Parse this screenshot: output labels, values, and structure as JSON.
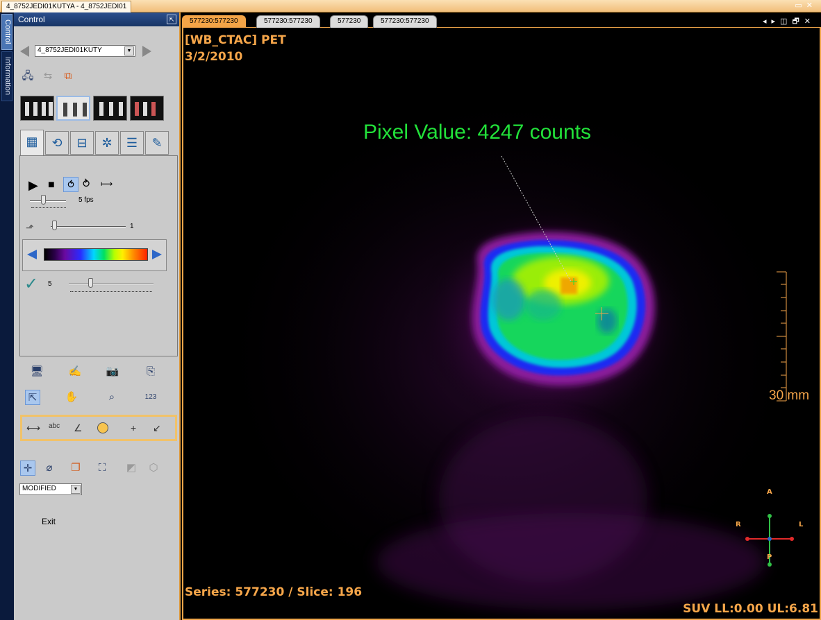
{
  "window": {
    "title": "4_8752JEDI01KUTYA - 4_8752JEDI01"
  },
  "side_tabs": {
    "control": "Control",
    "information": "Information"
  },
  "panel": {
    "header": "Control",
    "patient_select": "4_8752JEDI01KUTY",
    "frame_rate_label": "5 fps",
    "frame_step_value": "1",
    "threshold_value": "5",
    "mode_select": "MODIFIED",
    "exit_label": "Exit",
    "tool_tabs": [
      "layout-icon",
      "rotate-icon",
      "tree-icon",
      "settings-icon",
      "list-icon",
      "palette-icon"
    ]
  },
  "viewer": {
    "tabs": [
      "577230:577230",
      "577230:577230",
      "577230",
      "577230:577230"
    ],
    "active_tab": 0,
    "overlay": {
      "series_title": "[WB_CTAC] PET",
      "date": "3/2/2010",
      "pixel_value": "Pixel Value: 4247 counts",
      "scale_label": "30 mm",
      "series_slice": "Series: 577230 / Slice: 196",
      "suv": "SUV LL:0.00 UL:6.81",
      "orient_a": "A",
      "orient_p": "P",
      "orient_r": "R",
      "orient_l": "L"
    }
  },
  "colors": {
    "accent": "#f0a64a",
    "overlay_text": "#f6a64a",
    "annotation": "#22e13a",
    "panel_bg": "#cacaca"
  }
}
